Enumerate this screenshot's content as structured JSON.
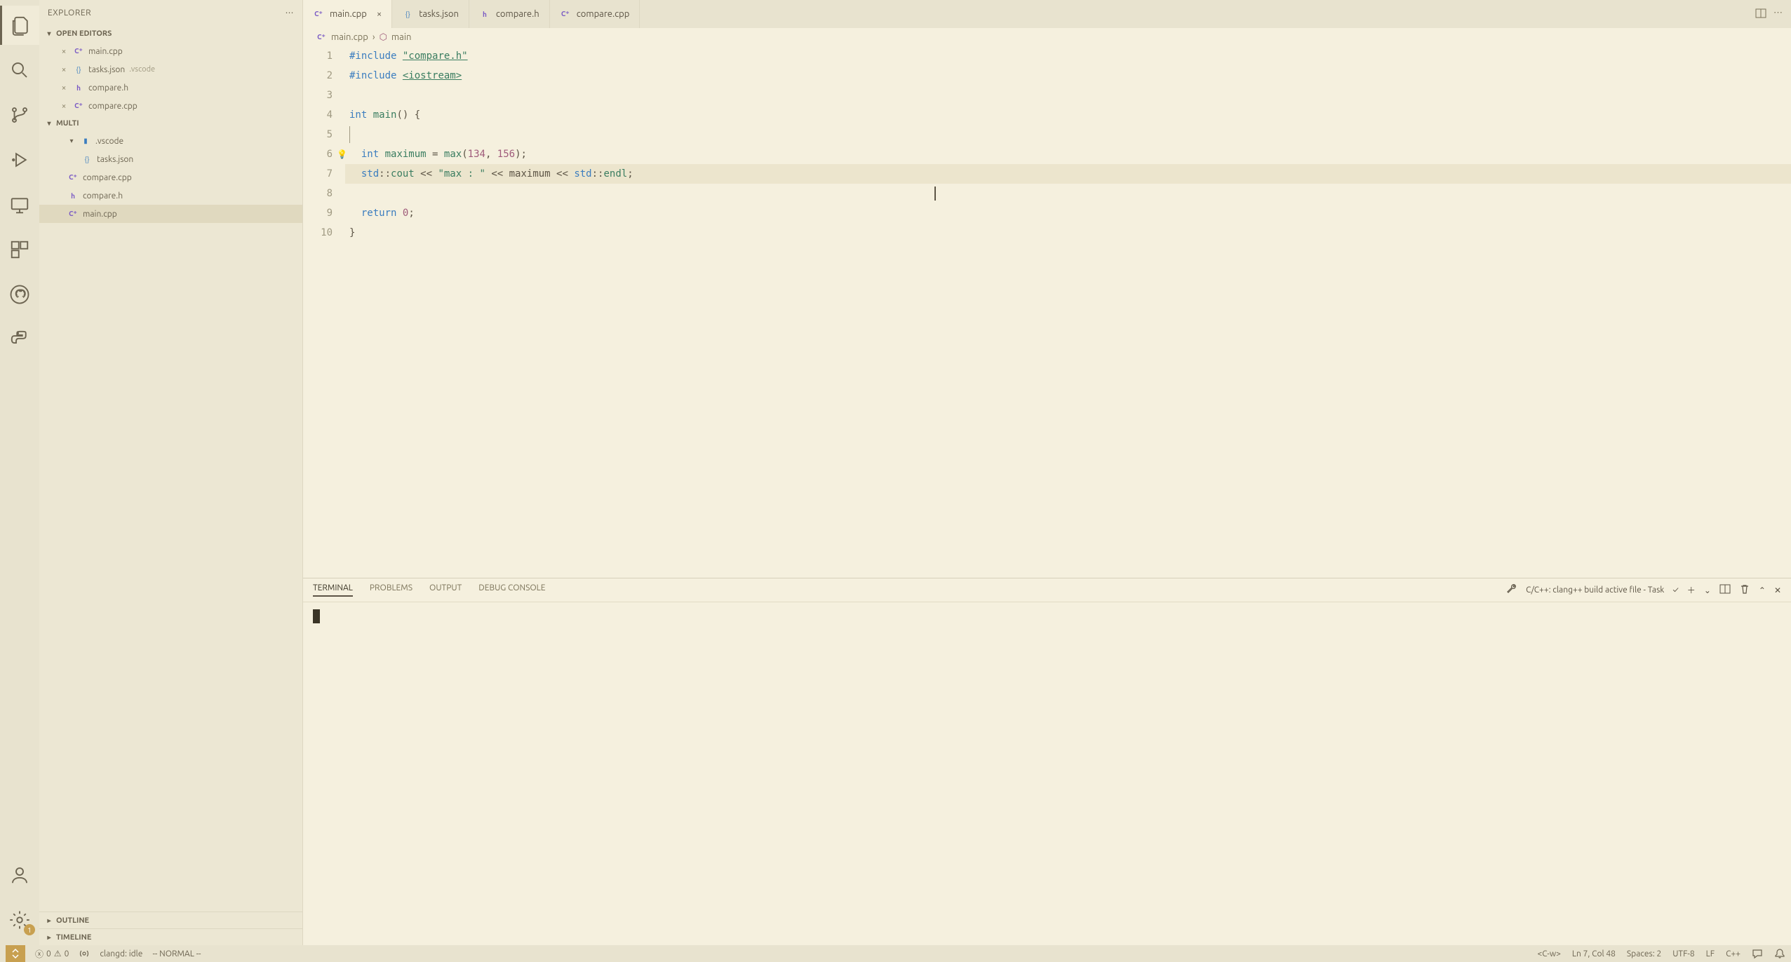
{
  "sidebar": {
    "title": "EXPLORER",
    "sections": {
      "open_editors": "OPEN EDITORS",
      "workspace": "MULTI",
      "outline": "OUTLINE",
      "timeline": "TIMELINE"
    },
    "open_editors": [
      {
        "name": "main.cpp",
        "type": "cpp"
      },
      {
        "name": "tasks.json",
        "type": "json",
        "dim": ".vscode"
      },
      {
        "name": "compare.h",
        "type": "h"
      },
      {
        "name": "compare.cpp",
        "type": "cpp"
      }
    ],
    "tree": {
      "folder": ".vscode",
      "folder_children": [
        {
          "name": "tasks.json",
          "type": "json"
        }
      ],
      "root_files": [
        {
          "name": "compare.cpp",
          "type": "cpp"
        },
        {
          "name": "compare.h",
          "type": "h"
        },
        {
          "name": "main.cpp",
          "type": "cpp",
          "active": true
        }
      ]
    }
  },
  "tabs": [
    {
      "name": "main.cpp",
      "type": "cpp",
      "active": true
    },
    {
      "name": "tasks.json",
      "type": "json"
    },
    {
      "name": "compare.h",
      "type": "h"
    },
    {
      "name": "compare.cpp",
      "type": "cpp"
    }
  ],
  "breadcrumb": {
    "file": "main.cpp",
    "symbol": "main"
  },
  "code": {
    "line_count": 10,
    "highlight_line": 7,
    "lines_html": [
      "<span class=\"kw\">#include</span> <span class=\"inc-str\">\"compare.h\"</span>",
      "<span class=\"kw\">#include</span> <span class=\"inc-str\">&lt;iostream&gt;</span>",
      "",
      "<span class=\"kw\">int</span> <span class=\"fn\">main</span>() {",
      "",
      "  <span class=\"kw\">int</span> <span class=\"fn\">maximum</span> = <span class=\"fn\">max</span>(<span class=\"num\">134</span>, <span class=\"num\">156</span>);",
      "  <span class=\"ns\">std</span>::<span class=\"fn\">cout</span> &lt;&lt; <span class=\"str\">\"max : \"</span> &lt;&lt; maximum &lt;&lt; <span class=\"ns\">std</span>::<span class=\"fn\">endl</span>;",
      "",
      "  <span class=\"kw\">return</span> <span class=\"num\">0</span>;",
      "}"
    ]
  },
  "panel": {
    "tabs": [
      "TERMINAL",
      "PROBLEMS",
      "OUTPUT",
      "DEBUG CONSOLE"
    ],
    "active_tab": 0,
    "task_label": "C/C++: clang++ build active file - Task"
  },
  "statusbar": {
    "errors": "0",
    "warnings": "0",
    "clangd": "clangd: idle",
    "vim_mode": "-- NORMAL --",
    "vim_prefix": "<C-w>",
    "position": "Ln 7, Col 48",
    "spaces": "Spaces: 2",
    "encoding": "UTF-8",
    "eol": "LF",
    "language": "C++"
  },
  "activity": {
    "settings_badge": "1"
  }
}
